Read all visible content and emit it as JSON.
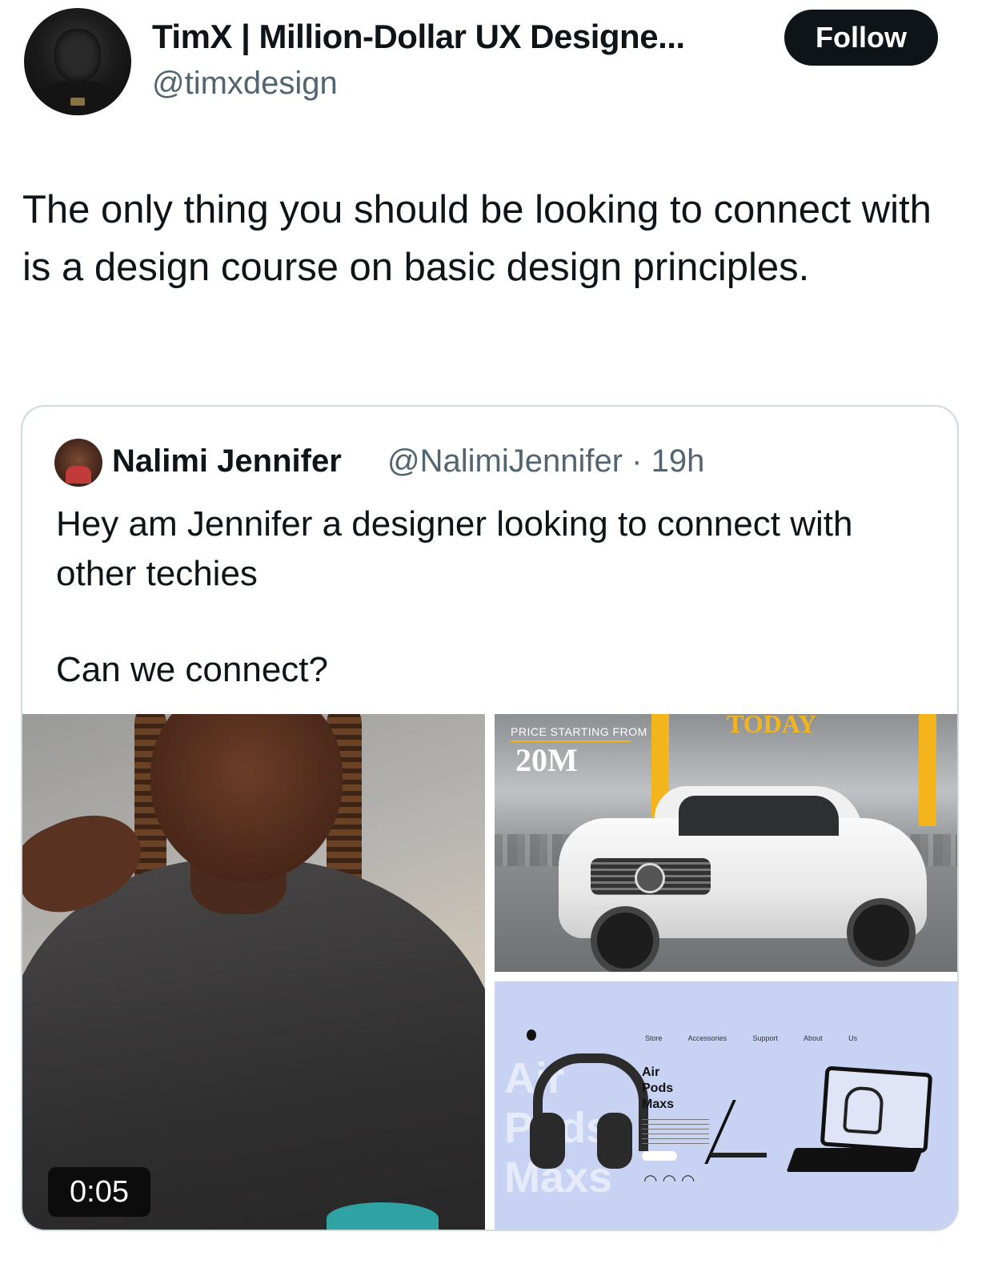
{
  "tweet": {
    "author_name": "TimX | Million-Dollar UX Designe...",
    "author_handle": "@timxdesign",
    "follow_label": "Follow",
    "text": "The only thing you should be looking to connect with is a design course on basic design principles."
  },
  "quote": {
    "author_name": "Nalimi Jennifer",
    "handle_time": "@NalimiJennifer · 19h",
    "text_line1": "Hey am Jennifer a designer looking to connect with other techies",
    "text_line2": "Can we connect?",
    "video_duration": "0:05",
    "car_promo": {
      "price_label": "PRICE STARTING FROM",
      "price": "20M",
      "headline": "TODAY"
    },
    "headphones_promo": {
      "nav": "Store Accessories Support About Us",
      "title_line1": "Air",
      "title_line2": "Pods",
      "title_line3": "Maxs",
      "bg_line1": "Air",
      "bg_line2": "Pods",
      "bg_line3": "Maxs"
    }
  },
  "colors": {
    "text": "#0f1419",
    "secondary": "#536471",
    "border": "#cfd9de",
    "accent_yellow": "#f3b51b",
    "promo_bg": "#c8d3f3"
  }
}
